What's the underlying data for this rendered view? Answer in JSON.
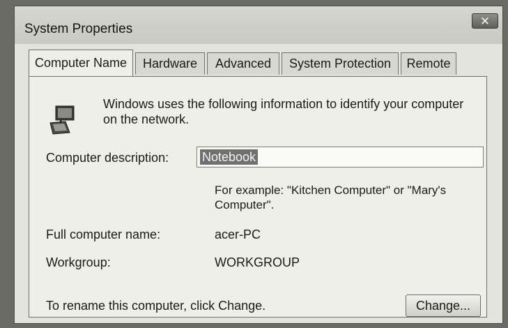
{
  "window": {
    "title": "System Properties",
    "close_glyph": "✕"
  },
  "tabs": [
    {
      "label": "Computer Name",
      "active": true
    },
    {
      "label": "Hardware",
      "active": false
    },
    {
      "label": "Advanced",
      "active": false
    },
    {
      "label": "System Protection",
      "active": false
    },
    {
      "label": "Remote",
      "active": false
    }
  ],
  "panel": {
    "icon": "computer-network-icon",
    "intro": "Windows uses the following information to identify your computer on the network.",
    "description_label": "Computer description:",
    "description_value": "Notebook",
    "example_text": "For example: \"Kitchen Computer\" or \"Mary's Computer\".",
    "full_name_label": "Full computer name:",
    "full_name_value": "acer-PC",
    "workgroup_label": "Workgroup:",
    "workgroup_value": "WORKGROUP",
    "rename_text": "To rename this computer, click Change.",
    "change_button": "Change..."
  }
}
